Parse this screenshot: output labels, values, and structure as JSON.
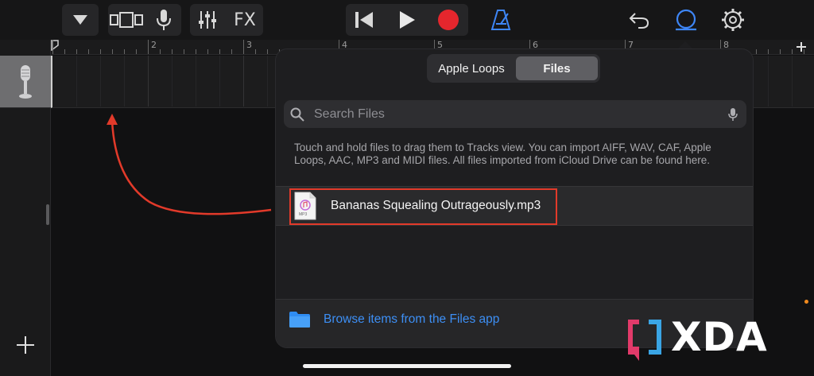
{
  "toolbar": {
    "fx_label": "FX"
  },
  "ruler": {
    "bars": [
      "2",
      "3",
      "4",
      "5",
      "6",
      "7",
      "8"
    ]
  },
  "loop_browser": {
    "tabs": [
      {
        "label": "Apple Loops",
        "active": false
      },
      {
        "label": "Files",
        "active": true
      }
    ],
    "search": {
      "placeholder": "Search Files",
      "value": ""
    },
    "hint": "Touch and hold files to drag them to Tracks view. You can import AIFF, WAV, CAF, Apple Loops, AAC, MP3 and MIDI files. All files imported from iCloud Drive can be found here.",
    "files": [
      {
        "name": "Bananas Squealing Outrageously.mp3",
        "type_badge": "MP3"
      }
    ],
    "browse_label": "Browse items from the Files app"
  },
  "watermark": {
    "text": "XDA"
  },
  "colors": {
    "accent_blue": "#3d8ff5",
    "record_red": "#e5262d",
    "annotation_red": "#e23a2a",
    "metronome_blue": "#3e86f6"
  }
}
